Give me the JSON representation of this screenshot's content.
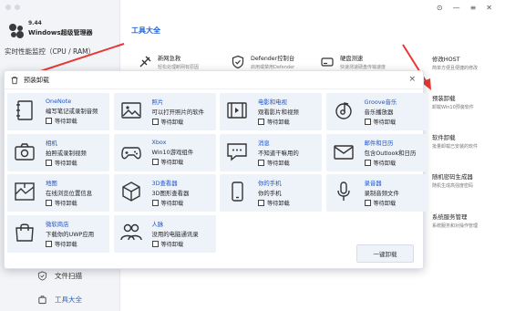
{
  "app": {
    "version": "9.44",
    "name": "Windows超级管理器",
    "monitor_label": "实时性能监控（CPU / RAM）"
  },
  "sidebar": {
    "items": [
      {
        "label": "文件扫描",
        "icon": "shield-check-icon"
      },
      {
        "label": "工具大全",
        "icon": "toolbox-icon"
      }
    ]
  },
  "main": {
    "title": "工具大全",
    "tools": [
      {
        "name": "新网急救",
        "desc": "轻松处理断网有原因",
        "icon": "network-icon"
      },
      {
        "name": "Defender控制台",
        "desc": "启用或禁用Defender",
        "icon": "shield-icon"
      },
      {
        "name": "硬盘测速",
        "desc": "快速测速硬盘传输速度",
        "icon": "disk-icon"
      }
    ],
    "right_tools": [
      {
        "name": "修改HOST",
        "desc": "简单方便且便捷的修改"
      },
      {
        "name": "预装卸载",
        "desc": "卸载Win10预装软件"
      },
      {
        "name": "软件卸载",
        "desc": "批量卸载已安装的软件"
      },
      {
        "name": "随机密码生成器",
        "desc": "随机生成高强度密码"
      },
      {
        "name": "系统服务管理",
        "desc": "系统服务和对操作管理"
      }
    ]
  },
  "modal": {
    "title": "预装卸载",
    "close": "×",
    "wait_label": "等待卸载",
    "uninstall_all": "一键卸载",
    "apps": [
      {
        "name": "OneNote",
        "desc": "编写笔记或录制音频",
        "icon": "notebook-icon"
      },
      {
        "name": "照片",
        "desc": "可以打开照片的软件",
        "icon": "photo-icon"
      },
      {
        "name": "电影和电视",
        "desc": "观看影片和视频",
        "icon": "film-icon"
      },
      {
        "name": "Groove音乐",
        "desc": "音乐播放器",
        "icon": "music-icon"
      },
      {
        "name": "相机",
        "desc": "拍照或录制视频",
        "icon": "camera-icon"
      },
      {
        "name": "Xbox",
        "desc": "Win10游戏组件",
        "icon": "gamepad-icon"
      },
      {
        "name": "消息",
        "desc": "不知道干嘛用的",
        "icon": "message-icon"
      },
      {
        "name": "邮件和日历",
        "desc": "包含Outlook和日历",
        "icon": "mail-icon"
      },
      {
        "name": "地图",
        "desc": "在线浏览位置信息",
        "icon": "map-icon"
      },
      {
        "name": "3D查看器",
        "desc": "3D图形查看器",
        "icon": "cube-icon"
      },
      {
        "name": "你的手机",
        "desc": "你的手机",
        "icon": "phone-icon"
      },
      {
        "name": "录音器",
        "desc": "录制音频文件",
        "icon": "microphone-icon"
      },
      {
        "name": "微软商店",
        "desc": "下载你的UWP应用",
        "icon": "store-icon"
      },
      {
        "name": "人脉",
        "desc": "没用的电脑通讯录",
        "icon": "people-icon"
      }
    ]
  },
  "colors": {
    "accent": "#1e63d6",
    "card_bg": "#eef2f9",
    "arrow": "#e53935"
  }
}
